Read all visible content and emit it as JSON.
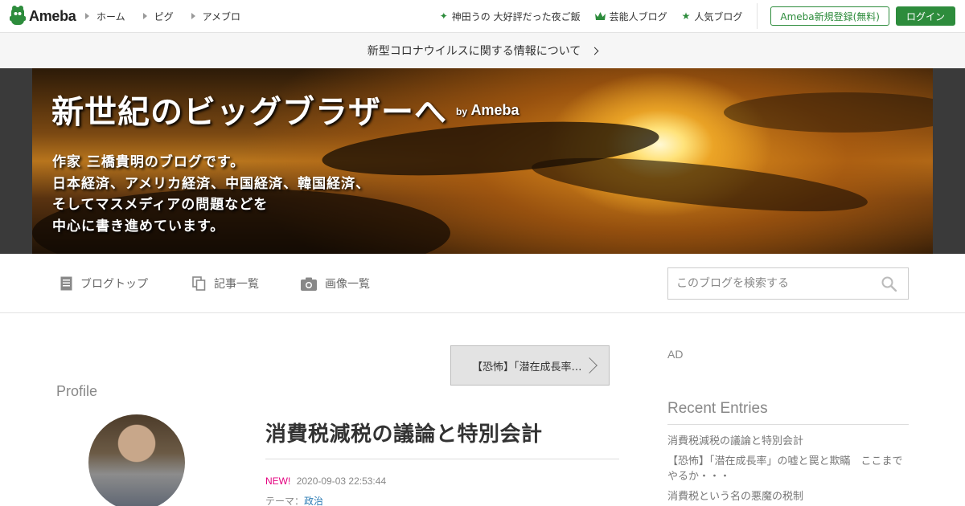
{
  "header": {
    "logo_text": "Ameba",
    "nav": [
      {
        "label": "ホーム"
      },
      {
        "label": "ピグ"
      },
      {
        "label": "アメブロ"
      }
    ],
    "picks": [
      {
        "label": "神田うの 大好評だった夜ご飯",
        "icon": "sparkle-icon"
      },
      {
        "label": "芸能人ブログ",
        "icon": "crown-icon"
      },
      {
        "label": "人気ブログ",
        "icon": "star-icon"
      }
    ],
    "register_label": "Ameba新規登録(無料)",
    "login_label": "ログイン",
    "accent_color": "#2d8c3c"
  },
  "notice": {
    "text": "新型コロナウイルスに関する情報について"
  },
  "banner": {
    "title": "新世紀のビッグブラザーへ",
    "by": "by",
    "by_brand": "Ameba",
    "description_lines": [
      "作家 三橋貴明のブログです。",
      "日本経済、アメリカ経済、中国経済、韓国経済、",
      "そしてマスメディアの問題などを",
      "中心に書き進めています。"
    ]
  },
  "blognav": {
    "items": [
      {
        "label": "ブログトップ",
        "icon": "document-icon"
      },
      {
        "label": "記事一覧",
        "icon": "copy-icon"
      },
      {
        "label": "画像一覧",
        "icon": "camera-icon"
      }
    ],
    "search_placeholder": "このブログを検索する"
  },
  "prev_article": {
    "label": "【恐怖】「潜在成長率」の嘘と罠と欺瞞"
  },
  "profile": {
    "heading": "Profile"
  },
  "article": {
    "title": "消費税減税の議論と特別会計",
    "new_badge": "NEW!",
    "datetime": "2020-09-03 22:53:44",
    "theme_label": "テーマ：",
    "theme_value": "政治"
  },
  "sidebar": {
    "ad_label": "AD",
    "recent_heading": "Recent Entries",
    "recent_entries": [
      "消費税減税の議論と特別会計",
      "【恐怖】「潜在成長率」の嘘と罠と欺瞞　ここまでやるか・・・",
      "消費税という名の悪魔の税制"
    ]
  }
}
